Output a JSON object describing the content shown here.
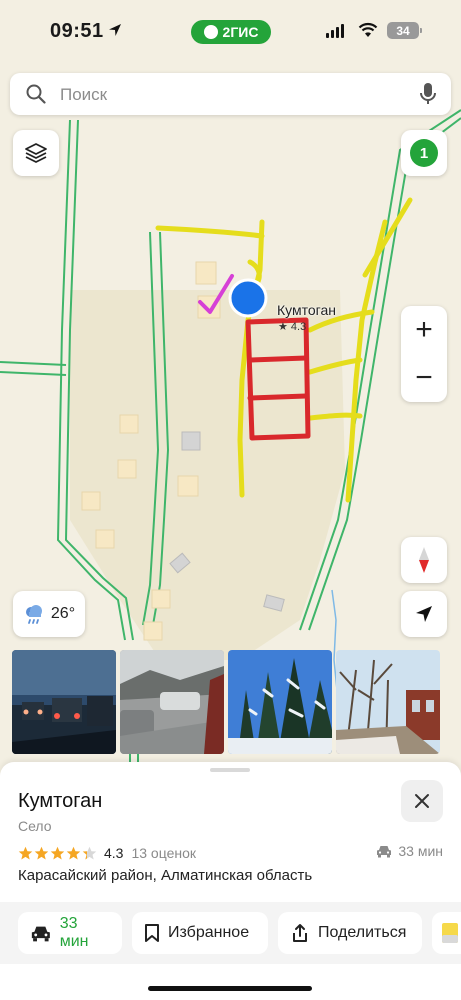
{
  "status_bar": {
    "time": "09:51",
    "app_badge": "2ГИС",
    "battery": "34",
    "brand_color": "#24a43a"
  },
  "search": {
    "placeholder": "Поиск",
    "icon": "search-icon",
    "mic_icon": "microphone-icon"
  },
  "map": {
    "layers_icon": "layers-icon",
    "notifications_count": "1",
    "zoom_in": "+",
    "zoom_out": "−",
    "weather_temp": "26°",
    "weather_icon": "rain-cloud-icon",
    "place_name": "Кумтоган",
    "place_rating": "★ 4.3",
    "annotation_colors": {
      "yellow": "#e5dd1c",
      "red": "#d9282c",
      "magenta": "#d640d6"
    },
    "road_color": "#3fb56a"
  },
  "photos": [
    {
      "name": "photo-traffic-evening"
    },
    {
      "name": "photo-road-car"
    },
    {
      "name": "photo-snowy-trees"
    },
    {
      "name": "photo-village-street"
    }
  ],
  "card": {
    "title": "Кумтоган",
    "category": "Село",
    "rating": "4.3",
    "rating_stars": 4.3,
    "reviews": "13 оценок",
    "drive_time": "33 мин",
    "address": "Карасайский район, Алматинская область",
    "star_color": "#f5a623"
  },
  "actions": {
    "route_time": "33 мин",
    "favorite": "Избранное",
    "share": "Поделиться"
  }
}
